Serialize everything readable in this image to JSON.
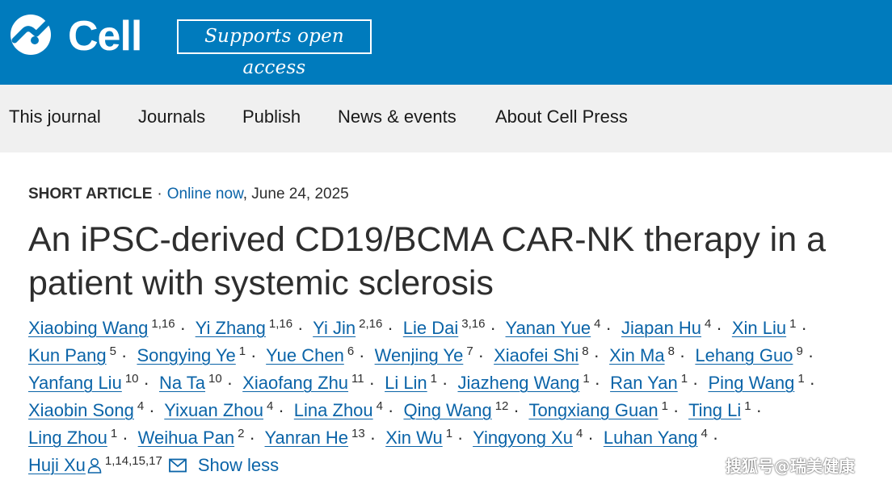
{
  "header": {
    "brand": "Cell",
    "open_access_label": "Supports open access",
    "colors": {
      "bar": "#007bbd",
      "link": "#0b64a8"
    }
  },
  "nav": {
    "items": [
      {
        "label": "This journal"
      },
      {
        "label": "Journals"
      },
      {
        "label": "Publish"
      },
      {
        "label": "News & events"
      },
      {
        "label": "About Cell Press"
      }
    ]
  },
  "article": {
    "type": "SHORT ARTICLE",
    "separator": "·",
    "status": "Online now",
    "date": ", June 24, 2025",
    "title": "An iPSC-derived CD19/BCMA CAR-NK therapy in a patient with systemic sclerosis",
    "authors": [
      {
        "name": "Xiaobing Wang",
        "aff": "1,16"
      },
      {
        "name": "Yi Zhang",
        "aff": "1,16"
      },
      {
        "name": "Yi Jin",
        "aff": "2,16"
      },
      {
        "name": "Lie Dai",
        "aff": "3,16"
      },
      {
        "name": "Yanan Yue",
        "aff": "4"
      },
      {
        "name": "Jiapan Hu",
        "aff": "4"
      },
      {
        "name": "Xin Liu",
        "aff": "1"
      },
      {
        "name": "Kun Pang",
        "aff": "5"
      },
      {
        "name": "Songying Ye",
        "aff": "1"
      },
      {
        "name": "Yue Chen",
        "aff": "6"
      },
      {
        "name": "Wenjing Ye",
        "aff": "7"
      },
      {
        "name": "Xiaofei Shi",
        "aff": "8"
      },
      {
        "name": "Xin Ma",
        "aff": "8"
      },
      {
        "name": "Lehang Guo",
        "aff": "9"
      },
      {
        "name": "Yanfang Liu",
        "aff": "10"
      },
      {
        "name": "Na Ta",
        "aff": "10"
      },
      {
        "name": "Xiaofang Zhu",
        "aff": "11"
      },
      {
        "name": "Li Lin",
        "aff": "1"
      },
      {
        "name": "Jiazheng Wang",
        "aff": "1"
      },
      {
        "name": "Ran Yan",
        "aff": "1"
      },
      {
        "name": "Ping Wang",
        "aff": "1"
      },
      {
        "name": "Xiaobin Song",
        "aff": "4"
      },
      {
        "name": "Yixuan Zhou",
        "aff": "4"
      },
      {
        "name": "Lina Zhou",
        "aff": "4"
      },
      {
        "name": "Qing Wang",
        "aff": "12"
      },
      {
        "name": "Tongxiang Guan",
        "aff": "1"
      },
      {
        "name": "Ting Li",
        "aff": "1"
      },
      {
        "name": "Ling Zhou",
        "aff": "1"
      },
      {
        "name": "Weihua Pan",
        "aff": "2"
      },
      {
        "name": "Yanran He",
        "aff": "13"
      },
      {
        "name": "Xin Wu",
        "aff": "1"
      },
      {
        "name": "Yingyong Xu",
        "aff": "4"
      },
      {
        "name": "Luhan Yang",
        "aff": "4"
      },
      {
        "name": "Huji Xu",
        "aff": "1,14,15,17",
        "corresponding": true
      }
    ],
    "show_less_label": "Show less"
  },
  "watermark": "搜狐号@瑞美健康",
  "icons": [
    "cell-logo-icon",
    "person-icon",
    "mail-icon"
  ]
}
